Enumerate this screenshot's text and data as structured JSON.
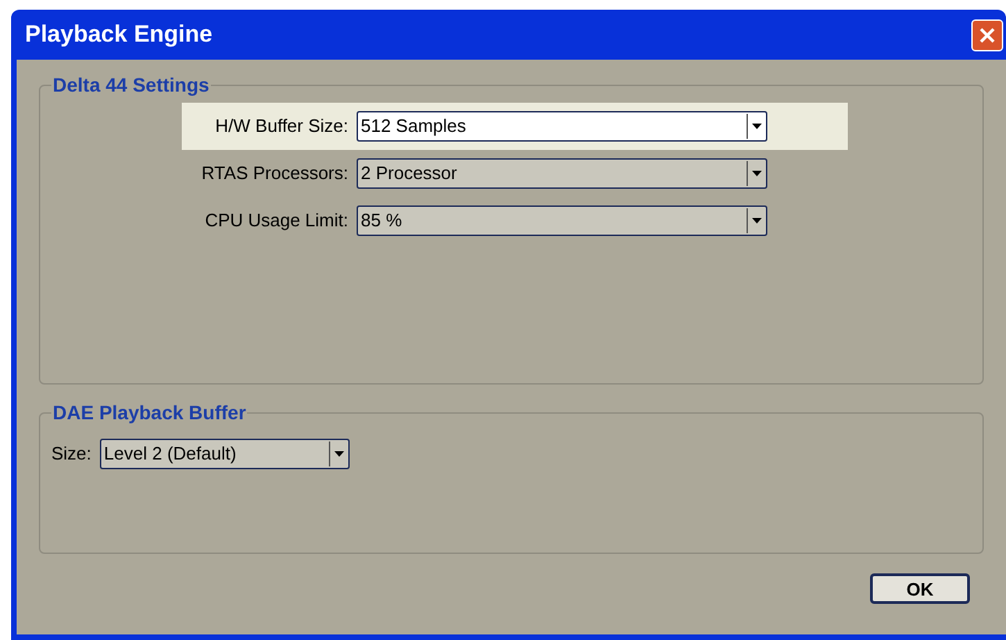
{
  "window": {
    "title": "Playback Engine"
  },
  "groups": [
    {
      "title": "Delta 44 Settings",
      "settings": [
        {
          "label": "H/W Buffer Size:",
          "value": "512 Samples",
          "highlighted": true
        },
        {
          "label": "RTAS Processors:",
          "value": "2 Processor",
          "highlighted": false
        },
        {
          "label": "CPU Usage Limit:",
          "value": "85 %",
          "highlighted": false
        }
      ]
    },
    {
      "title": "DAE Playback Buffer",
      "settings": [
        {
          "label": "Size:",
          "value": "Level 2 (Default)",
          "highlighted": false
        }
      ]
    }
  ],
  "buttons": [
    "OK"
  ]
}
